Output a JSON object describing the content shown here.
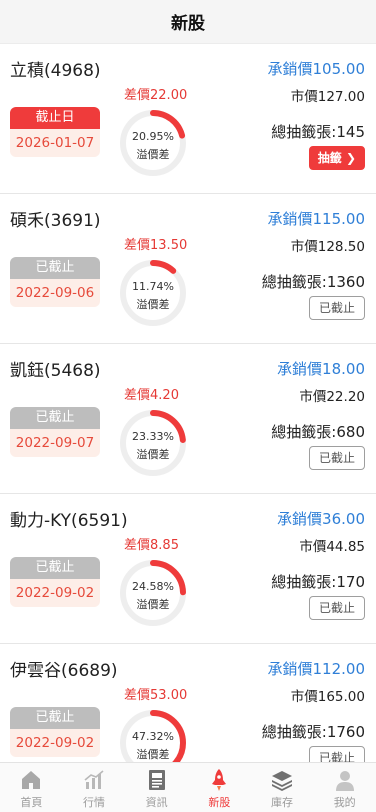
{
  "header": {
    "title": "新股"
  },
  "labels": {
    "spread_prefix": "差價",
    "underwrite_prefix": "承銷價",
    "market_prefix": "市價",
    "total_prefix": "總抽籤張:",
    "gauge_label": "溢價差"
  },
  "stocks": [
    {
      "name": "立積(4968)",
      "underwrite": "105.00",
      "market": "127.00",
      "spread": "22.00",
      "status": "截止日",
      "date": "2026-01-07",
      "premium_pct": "20.95%",
      "premium_value": 0.2095,
      "total": "145",
      "action": "抽籤 ❯",
      "open": true
    },
    {
      "name": "碩禾(3691)",
      "underwrite": "115.00",
      "market": "128.50",
      "spread": "13.50",
      "status": "已截止",
      "date": "2022-09-06",
      "premium_pct": "11.74%",
      "premium_value": 0.1174,
      "total": "1360",
      "action": "已截止",
      "open": false
    },
    {
      "name": "凱鈺(5468)",
      "underwrite": "18.00",
      "market": "22.20",
      "spread": "4.20",
      "status": "已截止",
      "date": "2022-09-07",
      "premium_pct": "23.33%",
      "premium_value": 0.2333,
      "total": "680",
      "action": "已截止",
      "open": false
    },
    {
      "name": "動力-KY(6591)",
      "underwrite": "36.00",
      "market": "44.85",
      "spread": "8.85",
      "status": "已截止",
      "date": "2022-09-02",
      "premium_pct": "24.58%",
      "premium_value": 0.2458,
      "total": "170",
      "action": "已截止",
      "open": false
    },
    {
      "name": "伊雲谷(6689)",
      "underwrite": "112.00",
      "market": "165.00",
      "spread": "53.00",
      "status": "已截止",
      "date": "2022-09-02",
      "premium_pct": "47.32%",
      "premium_value": 0.4732,
      "total": "1760",
      "action": "已截止",
      "open": false
    }
  ],
  "tabs": [
    {
      "label": "首頁",
      "icon": "home-icon",
      "active": false
    },
    {
      "label": "行情",
      "icon": "chart-icon",
      "active": false
    },
    {
      "label": "資訊",
      "icon": "news-icon",
      "active": false
    },
    {
      "label": "新股",
      "icon": "rocket-icon",
      "active": true
    },
    {
      "label": "庫存",
      "icon": "layers-icon",
      "active": false
    },
    {
      "label": "我的",
      "icon": "user-icon",
      "active": false
    }
  ],
  "colors": {
    "accent": "#ef3b3b",
    "underwrite": "#2f7fd7",
    "gauge_track": "#eeeeee",
    "gauge_fill": "#ef3b3b",
    "tab_inactive": "#9a9a9a"
  }
}
